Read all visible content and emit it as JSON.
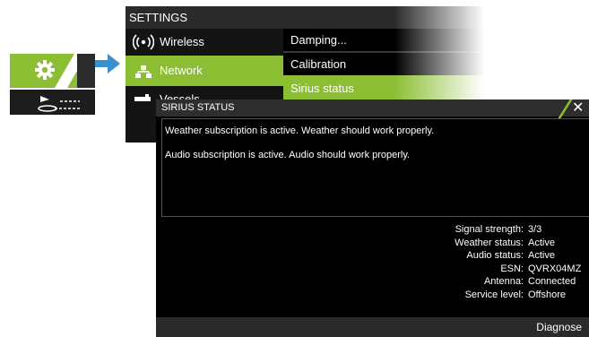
{
  "settings": {
    "title": "SETTINGS",
    "menu": [
      {
        "label": "Wireless",
        "icon": "wireless-icon"
      },
      {
        "label": "Network",
        "icon": "network-icon",
        "selected": true
      },
      {
        "label": "Vessels",
        "icon": "vessels-icon"
      }
    ],
    "submenu": [
      {
        "label": "Damping..."
      },
      {
        "label": "Calibration"
      },
      {
        "label": "Sirius status",
        "selected": true
      }
    ]
  },
  "sirius_dialog": {
    "title": "SIRIUS STATUS",
    "messages": [
      "Weather subscription is active. Weather should work properly.",
      "Audio subscription is active. Audio should work properly."
    ],
    "status": [
      {
        "key": "Signal strength:",
        "value": "3/3"
      },
      {
        "key": "Weather status:",
        "value": "Active"
      },
      {
        "key": "Audio status:",
        "value": "Active"
      },
      {
        "key": "ESN:",
        "value": "QVRX04MZ"
      },
      {
        "key": "Antenna:",
        "value": "Connected"
      },
      {
        "key": "Service level:",
        "value": "Offshore"
      }
    ],
    "diagnose_label": "Diagnose"
  },
  "colors": {
    "accent": "#8cbe34",
    "arrow": "#3a8fcd",
    "panel_bg": "#141414",
    "dialog_bg": "#000000"
  }
}
